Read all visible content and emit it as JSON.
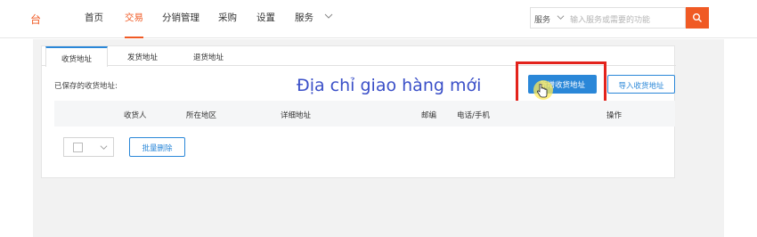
{
  "header": {
    "logo_text": "台",
    "nav": [
      {
        "label": "首页"
      },
      {
        "label": "交易"
      },
      {
        "label": "分销管理"
      },
      {
        "label": "采购"
      },
      {
        "label": "设置"
      },
      {
        "label": "服务"
      }
    ],
    "search": {
      "category": "服务",
      "placeholder": "输入服务或需要的功能"
    }
  },
  "tabs": [
    {
      "label": "收货地址"
    },
    {
      "label": "发货地址"
    },
    {
      "label": "退货地址"
    }
  ],
  "main": {
    "saved_label": "已保存的收货地址:",
    "overlay_caption": "Địa chỉ giao hàng mới",
    "add_button": "新增收货地址",
    "import_button": "导入收货地址",
    "columns": [
      "收货人",
      "所在地区",
      "详细地址",
      "邮编",
      "电话/手机",
      "操作"
    ],
    "bulk_delete": "批量删除"
  },
  "colors": {
    "brand": "#f05a24",
    "primary": "#2a87d8",
    "highlight": "#e3231c"
  }
}
